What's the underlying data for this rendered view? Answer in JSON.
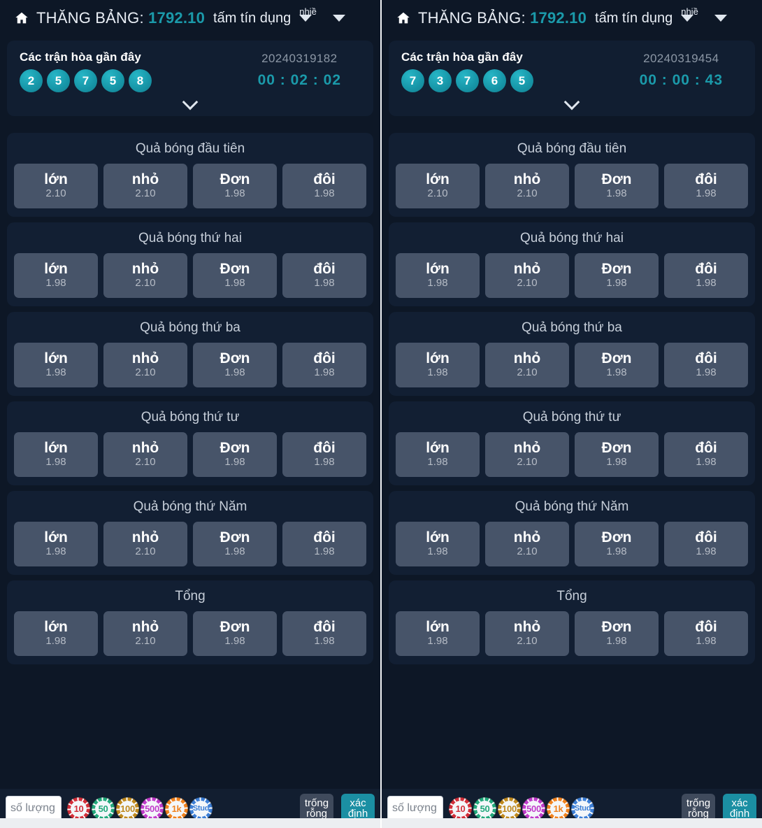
{
  "header": {
    "home_icon": "home-icon",
    "title_label": "THĂNG BẢNG:",
    "balance": "1792.10",
    "credit_label": "tấm tín dụng",
    "dropdown_label": "nhiề",
    "caret_icon": "chevron-down-icon"
  },
  "panels": [
    {
      "id": "left",
      "draws": {
        "title": "Các trận hòa gần đây",
        "balls": [
          "2",
          "5",
          "7",
          "5",
          "8"
        ],
        "draw_id": "20240319182",
        "timer": "00 : 02 : 02",
        "expand_icon": "chevron-down-icon"
      }
    },
    {
      "id": "right",
      "draws": {
        "title": "Các trận hòa gần đây",
        "balls": [
          "7",
          "3",
          "7",
          "6",
          "5"
        ],
        "draw_id": "20240319454",
        "timer": "00 : 00 : 43",
        "expand_icon": "chevron-down-icon"
      }
    }
  ],
  "markets": [
    {
      "title": "Quả bóng đầu tiên",
      "bets": [
        {
          "name": "lớn",
          "odd": "2.10"
        },
        {
          "name": "nhỏ",
          "odd": "2.10"
        },
        {
          "name": "Đơn",
          "odd": "1.98"
        },
        {
          "name": "đôi",
          "odd": "1.98"
        }
      ]
    },
    {
      "title": "Quả bóng thứ hai",
      "bets": [
        {
          "name": "lớn",
          "odd": "1.98"
        },
        {
          "name": "nhỏ",
          "odd": "2.10"
        },
        {
          "name": "Đơn",
          "odd": "1.98"
        },
        {
          "name": "đôi",
          "odd": "1.98"
        }
      ]
    },
    {
      "title": "Quả bóng thứ ba",
      "bets": [
        {
          "name": "lớn",
          "odd": "1.98"
        },
        {
          "name": "nhỏ",
          "odd": "2.10"
        },
        {
          "name": "Đơn",
          "odd": "1.98"
        },
        {
          "name": "đôi",
          "odd": "1.98"
        }
      ]
    },
    {
      "title": "Quả bóng thứ tư",
      "bets": [
        {
          "name": "lớn",
          "odd": "1.98"
        },
        {
          "name": "nhỏ",
          "odd": "2.10"
        },
        {
          "name": "Đơn",
          "odd": "1.98"
        },
        {
          "name": "đôi",
          "odd": "1.98"
        }
      ]
    },
    {
      "title": "Quả bóng thứ Năm",
      "bets": [
        {
          "name": "lớn",
          "odd": "1.98"
        },
        {
          "name": "nhỏ",
          "odd": "2.10"
        },
        {
          "name": "Đơn",
          "odd": "1.98"
        },
        {
          "name": "đôi",
          "odd": "1.98"
        }
      ]
    },
    {
      "title": "Tổng",
      "bets": [
        {
          "name": "lớn",
          "odd": "1.98"
        },
        {
          "name": "nhỏ",
          "odd": "2.10"
        },
        {
          "name": "Đơn",
          "odd": "1.98"
        },
        {
          "name": "đôi",
          "odd": "1.98"
        }
      ]
    }
  ],
  "bottombar": {
    "amount_placeholder": "số lượng",
    "amount_value": "",
    "chips": [
      {
        "label": "10",
        "color": "#d32f3a"
      },
      {
        "label": "50",
        "color": "#23a97c"
      },
      {
        "label": "100",
        "color": "#c08a1e"
      },
      {
        "label": "500",
        "color": "#c03ccb"
      },
      {
        "label": "1k",
        "color": "#f0821e"
      },
      {
        "label": "Stud",
        "color": "#3d7fd6"
      }
    ],
    "clear_line1": "trống",
    "clear_line2": "rỗng",
    "submit_line1": "xác",
    "submit_line2": "định"
  },
  "colors": {
    "background": "#0d1726",
    "card": "#111e31",
    "market": "#121f33",
    "accent": "#1b9aaa",
    "bet_button": "#475469",
    "submit": "#1b8fa3"
  }
}
